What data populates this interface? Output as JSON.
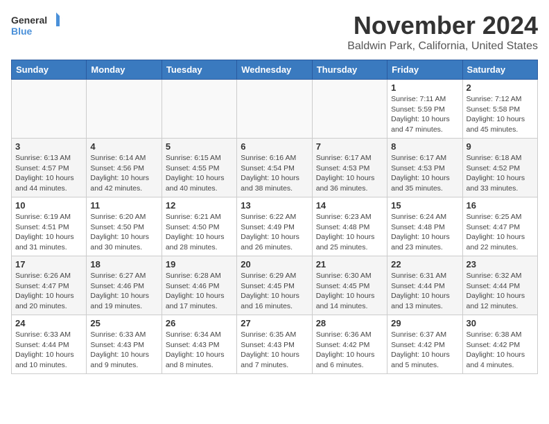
{
  "header": {
    "logo_general": "General",
    "logo_blue": "Blue",
    "month_year": "November 2024",
    "location": "Baldwin Park, California, United States"
  },
  "weekdays": [
    "Sunday",
    "Monday",
    "Tuesday",
    "Wednesday",
    "Thursday",
    "Friday",
    "Saturday"
  ],
  "weeks": [
    [
      {
        "day": "",
        "info": ""
      },
      {
        "day": "",
        "info": ""
      },
      {
        "day": "",
        "info": ""
      },
      {
        "day": "",
        "info": ""
      },
      {
        "day": "",
        "info": ""
      },
      {
        "day": "1",
        "info": "Sunrise: 7:11 AM\nSunset: 5:59 PM\nDaylight: 10 hours\nand 47 minutes."
      },
      {
        "day": "2",
        "info": "Sunrise: 7:12 AM\nSunset: 5:58 PM\nDaylight: 10 hours\nand 45 minutes."
      }
    ],
    [
      {
        "day": "3",
        "info": "Sunrise: 6:13 AM\nSunset: 4:57 PM\nDaylight: 10 hours\nand 44 minutes."
      },
      {
        "day": "4",
        "info": "Sunrise: 6:14 AM\nSunset: 4:56 PM\nDaylight: 10 hours\nand 42 minutes."
      },
      {
        "day": "5",
        "info": "Sunrise: 6:15 AM\nSunset: 4:55 PM\nDaylight: 10 hours\nand 40 minutes."
      },
      {
        "day": "6",
        "info": "Sunrise: 6:16 AM\nSunset: 4:54 PM\nDaylight: 10 hours\nand 38 minutes."
      },
      {
        "day": "7",
        "info": "Sunrise: 6:17 AM\nSunset: 4:53 PM\nDaylight: 10 hours\nand 36 minutes."
      },
      {
        "day": "8",
        "info": "Sunrise: 6:17 AM\nSunset: 4:53 PM\nDaylight: 10 hours\nand 35 minutes."
      },
      {
        "day": "9",
        "info": "Sunrise: 6:18 AM\nSunset: 4:52 PM\nDaylight: 10 hours\nand 33 minutes."
      }
    ],
    [
      {
        "day": "10",
        "info": "Sunrise: 6:19 AM\nSunset: 4:51 PM\nDaylight: 10 hours\nand 31 minutes."
      },
      {
        "day": "11",
        "info": "Sunrise: 6:20 AM\nSunset: 4:50 PM\nDaylight: 10 hours\nand 30 minutes."
      },
      {
        "day": "12",
        "info": "Sunrise: 6:21 AM\nSunset: 4:50 PM\nDaylight: 10 hours\nand 28 minutes."
      },
      {
        "day": "13",
        "info": "Sunrise: 6:22 AM\nSunset: 4:49 PM\nDaylight: 10 hours\nand 26 minutes."
      },
      {
        "day": "14",
        "info": "Sunrise: 6:23 AM\nSunset: 4:48 PM\nDaylight: 10 hours\nand 25 minutes."
      },
      {
        "day": "15",
        "info": "Sunrise: 6:24 AM\nSunset: 4:48 PM\nDaylight: 10 hours\nand 23 minutes."
      },
      {
        "day": "16",
        "info": "Sunrise: 6:25 AM\nSunset: 4:47 PM\nDaylight: 10 hours\nand 22 minutes."
      }
    ],
    [
      {
        "day": "17",
        "info": "Sunrise: 6:26 AM\nSunset: 4:47 PM\nDaylight: 10 hours\nand 20 minutes."
      },
      {
        "day": "18",
        "info": "Sunrise: 6:27 AM\nSunset: 4:46 PM\nDaylight: 10 hours\nand 19 minutes."
      },
      {
        "day": "19",
        "info": "Sunrise: 6:28 AM\nSunset: 4:46 PM\nDaylight: 10 hours\nand 17 minutes."
      },
      {
        "day": "20",
        "info": "Sunrise: 6:29 AM\nSunset: 4:45 PM\nDaylight: 10 hours\nand 16 minutes."
      },
      {
        "day": "21",
        "info": "Sunrise: 6:30 AM\nSunset: 4:45 PM\nDaylight: 10 hours\nand 14 minutes."
      },
      {
        "day": "22",
        "info": "Sunrise: 6:31 AM\nSunset: 4:44 PM\nDaylight: 10 hours\nand 13 minutes."
      },
      {
        "day": "23",
        "info": "Sunrise: 6:32 AM\nSunset: 4:44 PM\nDaylight: 10 hours\nand 12 minutes."
      }
    ],
    [
      {
        "day": "24",
        "info": "Sunrise: 6:33 AM\nSunset: 4:44 PM\nDaylight: 10 hours\nand 10 minutes."
      },
      {
        "day": "25",
        "info": "Sunrise: 6:33 AM\nSunset: 4:43 PM\nDaylight: 10 hours\nand 9 minutes."
      },
      {
        "day": "26",
        "info": "Sunrise: 6:34 AM\nSunset: 4:43 PM\nDaylight: 10 hours\nand 8 minutes."
      },
      {
        "day": "27",
        "info": "Sunrise: 6:35 AM\nSunset: 4:43 PM\nDaylight: 10 hours\nand 7 minutes."
      },
      {
        "day": "28",
        "info": "Sunrise: 6:36 AM\nSunset: 4:42 PM\nDaylight: 10 hours\nand 6 minutes."
      },
      {
        "day": "29",
        "info": "Sunrise: 6:37 AM\nSunset: 4:42 PM\nDaylight: 10 hours\nand 5 minutes."
      },
      {
        "day": "30",
        "info": "Sunrise: 6:38 AM\nSunset: 4:42 PM\nDaylight: 10 hours\nand 4 minutes."
      }
    ]
  ]
}
